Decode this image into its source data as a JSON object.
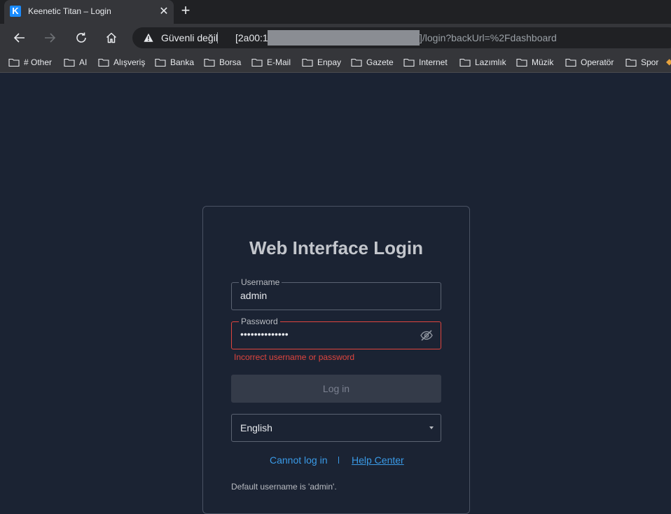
{
  "browser": {
    "tab_title": "Keenetic Titan – Login",
    "tab_close": "✕",
    "new_tab": "+",
    "security_label": "Güvenli değil",
    "url_host": "[2a00:1c",
    "url_path": "]/login?backUrl=%2Fdashboard"
  },
  "bookmarks": [
    {
      "label": "# Other"
    },
    {
      "label": "AI"
    },
    {
      "label": "Alışveriş"
    },
    {
      "label": "Banka"
    },
    {
      "label": "Borsa"
    },
    {
      "label": "E-Mail"
    },
    {
      "label": "Enpay"
    },
    {
      "label": "Gazete"
    },
    {
      "label": "Internet"
    },
    {
      "label": "Lazımlık"
    },
    {
      "label": "Müzik"
    },
    {
      "label": "Operatör"
    },
    {
      "label": "Spor"
    }
  ],
  "login": {
    "title": "Web Interface Login",
    "username_label": "Username",
    "username_value": "admin",
    "password_label": "Password",
    "password_value": "••••••••••••••",
    "error": "Incorrect username or password",
    "login_button": "Log in",
    "language": "English",
    "cannot_login": "Cannot log in",
    "help_center": "Help Center",
    "default_note": "Default username is 'admin'."
  },
  "colors": {
    "page_bg": "#1b2333",
    "error": "#e0453e",
    "link": "#3a9be8"
  }
}
